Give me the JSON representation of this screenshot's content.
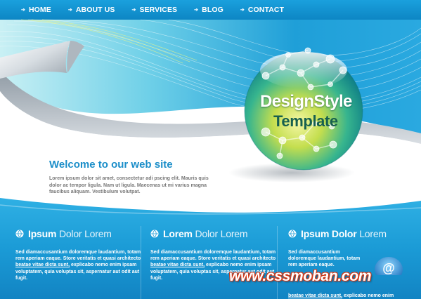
{
  "nav": {
    "items": [
      {
        "label": "HOME"
      },
      {
        "label": "ABOUT US"
      },
      {
        "label": "SERVICES"
      },
      {
        "label": "BLOG"
      },
      {
        "label": "CONTACT"
      }
    ]
  },
  "logo": {
    "line1": "DesignStyle",
    "line2": "Template"
  },
  "welcome": {
    "title": "Welcome to our web site",
    "body": "Lorem ipsum dolor sit amet, consectetur adi pscing elit. Mauris quis dolor ac tempor ligula. Nam ut ligula. Maecenas ut mi varius magna faucibus aliquam. Vestibulum volutpat."
  },
  "columns": [
    {
      "title_bold": "Ipsum",
      "title_light": "Dolor Lorem",
      "text_before": "Sed diamaccusantium doloremque laudantium, totam rem aperiam eaque. Store veritatis et quasi architecto ",
      "link": "beatae vitae dicta sunt,",
      "text_after": " explicabo nemo enim ipsam voluptatem, quia voluptas sit, aspernatur aut odit aut fugit."
    },
    {
      "title_bold": "Lorem",
      "title_light": "Dolor Lorem",
      "text_before": "Sed diamaccusantium doloremque laudantium, totam rem aperiam eaque. Store veritatis et quasi architecto ",
      "link": "beatae vitae dicta sunt,",
      "text_after": " explicabo nemo enim ipsam voluptatem, quia voluptas sit, aspernatur aut odit aut fugit."
    },
    {
      "title_bold": "Ipsum Dolor",
      "title_light": "Lorem",
      "text_before": "Sed diamaccusantium doloremque laudantium, totam rem aperiam eaque.",
      "link": "beatae vitae dicta sunt,",
      "text_after": " explicabo nemo enim"
    }
  ],
  "watermark": {
    "part1": "www.css",
    "part2": "moban.com"
  },
  "colors": {
    "accent_blue": "#1b9bd6",
    "title_blue": "#1b8ec9",
    "sphere_green": "#8cc63f",
    "watermark_red": "#d23a1a"
  },
  "icons": [
    "arrow-right-icon",
    "globe-icon",
    "at-sign-icon"
  ]
}
